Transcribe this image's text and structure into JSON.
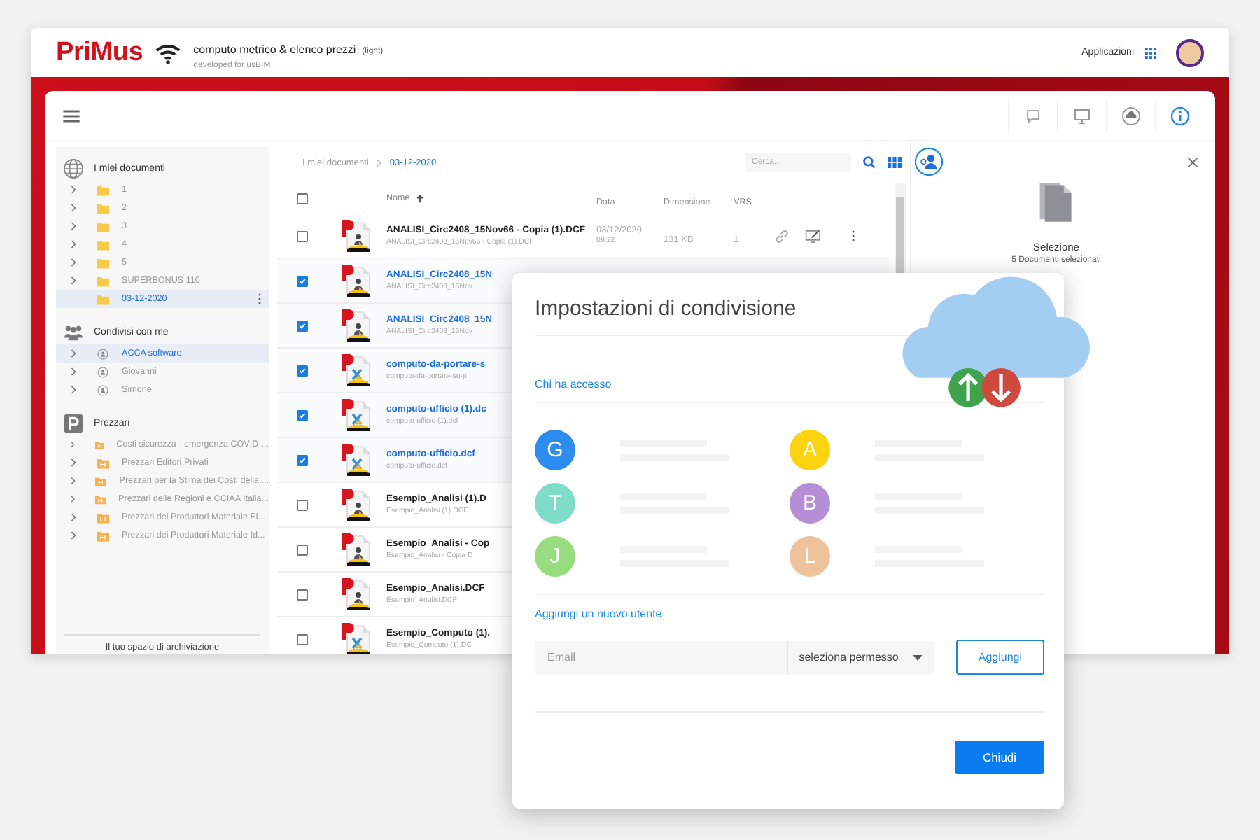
{
  "header": {
    "logo": "PriMus",
    "product": "computo metrico & elenco prezzi",
    "edition": "(light)",
    "subtitle": "developed for usBIM",
    "apps_label": "Applicazioni"
  },
  "sidebar": {
    "sections": [
      {
        "kind": "globe",
        "title": "I miei documenti",
        "items": [
          {
            "kind": "folder",
            "label": "1",
            "expandable": true,
            "selected": false
          },
          {
            "kind": "folder",
            "label": "2",
            "expandable": true,
            "selected": false
          },
          {
            "kind": "folder",
            "label": "3",
            "expandable": true,
            "selected": false
          },
          {
            "kind": "folder",
            "label": "4",
            "expandable": true,
            "selected": false
          },
          {
            "kind": "folder",
            "label": "5",
            "expandable": true,
            "selected": false
          },
          {
            "kind": "folder",
            "label": "SUPERBONUS 110",
            "expandable": true,
            "selected": false
          },
          {
            "kind": "folder",
            "label": "03-12-2020",
            "expandable": false,
            "selected": true
          }
        ]
      },
      {
        "kind": "people",
        "title": "Condivisi con me",
        "items": [
          {
            "kind": "user",
            "label": "ACCA software",
            "expandable": true,
            "selected": true
          },
          {
            "kind": "user",
            "label": "Giovanni",
            "expandable": true,
            "selected": false
          },
          {
            "kind": "user",
            "label": "Simone",
            "expandable": true,
            "selected": false
          }
        ]
      },
      {
        "kind": "pricelist",
        "title": "Prezzari",
        "items": [
          {
            "kind": "pricelist",
            "label": "Costi sicurezza - emergenza COVID-...",
            "expandable": true,
            "selected": false
          },
          {
            "kind": "pricelist",
            "label": "Prezzari Editori Privati",
            "expandable": true,
            "selected": false
          },
          {
            "kind": "pricelist",
            "label": "Prezzari per la Stima dei Costi della ...",
            "expandable": true,
            "selected": false
          },
          {
            "kind": "pricelist",
            "label": "Prezzari delle Regioni e CCIAA Italia...",
            "expandable": true,
            "selected": false
          },
          {
            "kind": "pricelist",
            "label": "Prezzari dei Produttori Materiale El...",
            "expandable": true,
            "selected": false
          },
          {
            "kind": "pricelist",
            "label": "Prezzari dei Produttori Materiale Id...",
            "expandable": true,
            "selected": false
          }
        ]
      }
    ],
    "storage_label": "Il tuo spazio di archiviazione"
  },
  "breadcrumb": [
    "I miei documenti",
    "03-12-2020"
  ],
  "search": {
    "placeholder": "Cerca..."
  },
  "table": {
    "all_selected": false,
    "columns": [
      "Nome",
      "Data",
      "Dimensione",
      "VRS"
    ],
    "rows": [
      {
        "kind": "analisi",
        "name": "ANALISI_Circ2408_15Nov66 - Copia (1).DCF",
        "file": "ANALISI_Circ2408_15Nov66 - Copia (1).DCF",
        "date": "03/12/2020",
        "time": "09:22",
        "size": "131 KB",
        "vrs": "1",
        "selected": false
      },
      {
        "kind": "analisi",
        "name": "ANALISI_Circ2408_15N",
        "file": "ANALISI_Circ2408_15Nov",
        "selected": true
      },
      {
        "kind": "analisi",
        "name": "ANALISI_Circ2408_15N",
        "file": "ANALISI_Circ2408_15Nov",
        "selected": true
      },
      {
        "kind": "computo",
        "name": "computo-da-portare-s",
        "file": "computo-da-portare-su-p",
        "selected": true
      },
      {
        "kind": "computo",
        "name": "computo-ufficio (1).dc",
        "file": "computo-ufficio (1).dcf",
        "selected": true
      },
      {
        "kind": "computo",
        "name": "computo-ufficio.dcf",
        "file": "computo-ufficio.dcf",
        "selected": true
      },
      {
        "kind": "analisi",
        "name": "Esempio_Analisi (1).D",
        "file": "Esempio_Analisi (1).DCF",
        "selected": false
      },
      {
        "kind": "analisi",
        "name": "Esempio_Analisi - Cop",
        "file": "Esempio_Analisi - Copia D",
        "selected": false
      },
      {
        "kind": "analisi",
        "name": "Esempio_Analisi.DCF",
        "file": "Esempio_Analisi.DCF",
        "selected": false
      },
      {
        "kind": "computo",
        "name": "Esempio_Computo (1).",
        "file": "Esempio_Computo (1).DC",
        "selected": false
      }
    ]
  },
  "details": {
    "title": "Selezione",
    "subtitle": "5 Documenti selezionati"
  },
  "dialog": {
    "title": "Impostazioni di condivisione",
    "access_label": "Chi ha accesso",
    "users": [
      {
        "initial": "G",
        "color": "#2d8cf0"
      },
      {
        "initial": "A",
        "color": "#fdd20e"
      },
      {
        "initial": "T",
        "color": "#7fdcc9"
      },
      {
        "initial": "B",
        "color": "#b48fd8"
      },
      {
        "initial": "J",
        "color": "#97dc7e"
      },
      {
        "initial": "L",
        "color": "#eec29a"
      }
    ],
    "add_label": "Aggiungi un nuovo utente",
    "email_placeholder": "Email",
    "permission": "seleziona permesso",
    "add_button": "Aggiungi",
    "close_button": "Chiudi"
  }
}
